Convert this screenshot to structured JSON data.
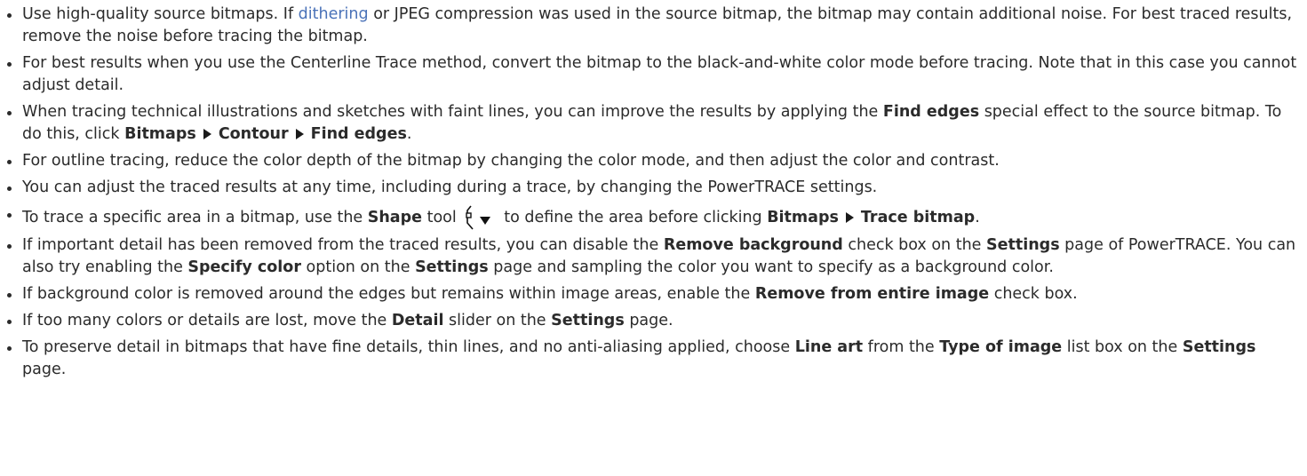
{
  "tips": {
    "t1": {
      "a": "Use high-quality source bitmaps. If ",
      "link": "dithering",
      "b": " or JPEG compression was used in the source bitmap, the bitmap may contain additional noise. For best traced results, remove the noise before tracing the bitmap."
    },
    "t2": {
      "a": "For best results when you use the Centerline Trace method, convert the bitmap to the black-and-white color mode before tracing. Note that in this case you cannot adjust detail."
    },
    "t3": {
      "a": "When tracing technical illustrations and sketches with faint lines, you can improve the results by applying the ",
      "b1": "Find edges",
      "b": " special effect to the source bitmap. To do this, click ",
      "m1": "Bitmaps",
      "m2": "Contour",
      "m3": "Find edges",
      "c": "."
    },
    "t4": {
      "a": "For outline tracing, reduce the color depth of the bitmap by changing the color mode, and then adjust the color and contrast."
    },
    "t5": {
      "a": "You can adjust the traced results at any time, including during a trace, by changing the PowerTRACE settings."
    },
    "t6": {
      "a": "To trace a specific area in a bitmap, use the ",
      "b1": "Shape",
      "b": " tool",
      "c": " to define the area before clicking ",
      "m1": "Bitmaps",
      "m2": "Trace bitmap",
      "d": ".",
      "icon": "shape-tool-icon"
    },
    "t7": {
      "a": "If important detail has been removed from the traced results, you can disable the ",
      "b1": "Remove background",
      "b": " check box on the ",
      "b2": "Settings",
      "c": " page of PowerTRACE. You can also try enabling the ",
      "b3": "Specify color",
      "d": " option on the ",
      "b4": "Settings",
      "e": " page and sampling the color you want to specify as a background color."
    },
    "t8": {
      "a": "If background color is removed around the edges but remains within image areas, enable the ",
      "b1": "Remove from entire image",
      "b": " check box."
    },
    "t9": {
      "a": "If too many colors or details are lost, move the ",
      "b1": "Detail",
      "b": " slider on the ",
      "b2": "Settings",
      "c": " page."
    },
    "t10": {
      "a": "To preserve detail in bitmaps that have fine details, thin lines, and no anti-aliasing applied, choose ",
      "b1": "Line art",
      "b": " from the ",
      "b2": "Type of image",
      "c": " list box on the ",
      "b3": "Settings",
      "d": " page."
    }
  },
  "colors": {
    "text": "#2b2b2b",
    "link": "#4a72b8"
  }
}
